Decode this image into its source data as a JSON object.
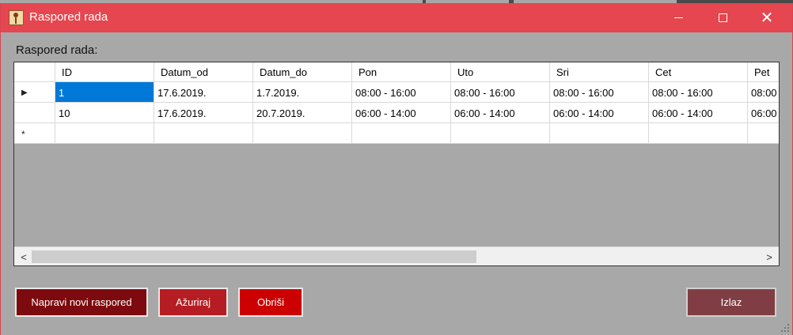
{
  "window": {
    "title": "Raspored rada",
    "minimize": "—",
    "maximize": "□",
    "close": "✕"
  },
  "section_label": "Raspored rada:",
  "grid": {
    "columns": [
      "ID",
      "Datum_od",
      "Datum_do",
      "Pon",
      "Uto",
      "Sri",
      "Cet",
      "Pet"
    ],
    "rows": [
      {
        "marker": "▶",
        "cells": [
          "1",
          "17.6.2019.",
          "1.7.2019.",
          "08:00 - 16:00",
          "08:00 - 16:00",
          "08:00 - 16:00",
          "08:00 - 16:00",
          "08:00"
        ]
      },
      {
        "marker": "",
        "cells": [
          "10",
          "17.6.2019.",
          "20.7.2019.",
          "06:00 - 14:00",
          "06:00 - 14:00",
          "06:00 - 14:00",
          "06:00 - 14:00",
          "06:00"
        ]
      }
    ],
    "new_row_marker": "*",
    "scroll_left": "<",
    "scroll_right": ">"
  },
  "buttons": {
    "new": "Napravi novi raspored",
    "update": "Ažuriraj",
    "delete": "Obriši",
    "exit": "Izlaz"
  },
  "colors": {
    "titlebar": "#e5464f",
    "selection": "#0078d7",
    "btn_new": "#7d0a0e",
    "btn_update": "#b51d22",
    "btn_delete": "#cc0000",
    "btn_exit": "#803e44"
  }
}
